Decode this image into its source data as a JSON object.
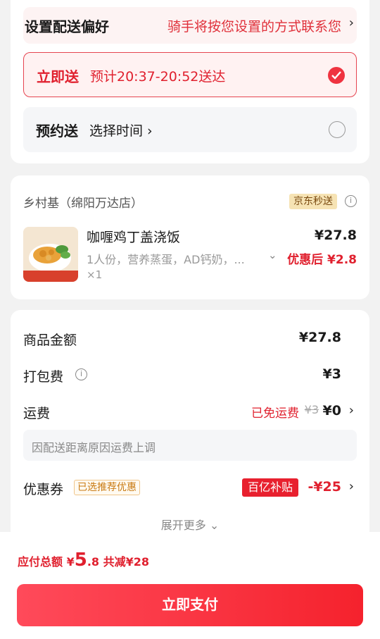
{
  "delivery": {
    "preference_title": "设置配送偏好",
    "preference_hint": "骑手将按您设置的方式联系您",
    "chevron": "›",
    "option_now": {
      "name": "立即送",
      "desc": "预计20:37-20:52送达",
      "selected": true
    },
    "option_schedule": {
      "name": "预约送",
      "desc": "选择时间 ›",
      "selected": false
    }
  },
  "store": {
    "name": "乡村基（绵阳万达店）",
    "badge": "京东秒送",
    "info_icon": "i",
    "item": {
      "name": "咖喱鸡丁盖浇饭",
      "desc": "1人份，营养蒸蛋，AD钙奶，...",
      "expand": "⌄",
      "qty": "×1",
      "price": "¥27.8",
      "discount_price": "优惠后 ¥2.8"
    }
  },
  "summary": {
    "goods_label": "商品金额",
    "goods_value": "¥27.8",
    "packing_label": "打包费",
    "packing_value": "¥3",
    "shipping_label": "运费",
    "shipping_free": "已免运费",
    "shipping_original": "¥3",
    "shipping_value": "¥0",
    "shipping_note": "因配送距离原因运费上调",
    "coupon_label": "优惠券",
    "coupon_tag": "已选推荐优惠",
    "subsidy_tag": "百亿补贴",
    "coupon_value": "-¥25",
    "expand_more": "展开更多 ⌄"
  },
  "footer": {
    "total_label": "应付总额",
    "currency": "¥",
    "total_int": "5",
    "total_dec": ".8",
    "saved": "共减¥28",
    "pay_button": "立即支付"
  },
  "colors": {
    "accent": "#e0202e",
    "badge_bg": "#f6e3b4"
  }
}
